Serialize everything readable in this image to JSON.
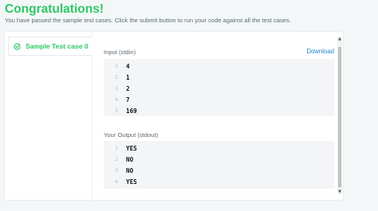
{
  "header": {
    "title": "Congratulations!",
    "subtitle": "You have passed the sample test cases. Click the submit button to run your code against all the test cases."
  },
  "sidebar": {
    "test_case_label": "Sample Test case 0"
  },
  "input_section": {
    "label": "Input (stdin)",
    "download_label": "Download",
    "lines": [
      {
        "num": "1",
        "value": "4"
      },
      {
        "num": "2",
        "value": "1"
      },
      {
        "num": "3",
        "value": "2"
      },
      {
        "num": "4",
        "value": "7"
      },
      {
        "num": "5",
        "value": "169"
      }
    ]
  },
  "output_section": {
    "label": "Your Output (stdout)",
    "lines": [
      {
        "num": "1",
        "value": "YES"
      },
      {
        "num": "2",
        "value": "NO"
      },
      {
        "num": "3",
        "value": "NO"
      },
      {
        "num": "4",
        "value": "YES"
      }
    ]
  },
  "scrollbar": {
    "up_arrow": "▲",
    "down_arrow": "▼"
  },
  "colors": {
    "success": "#2ec866",
    "link": "#1f8acb",
    "code_bg": "#f4f5f6"
  },
  "icons": {
    "test_case_status": "check-circle-icon"
  }
}
